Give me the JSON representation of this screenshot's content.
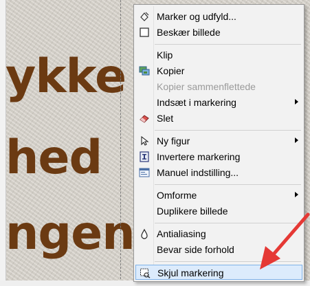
{
  "background": {
    "words": [
      "ykke",
      "hed",
      "ngen"
    ],
    "text_color": "#6b3a12"
  },
  "menu": {
    "items": [
      {
        "label": "Marker og udfyld...",
        "icon": "fill-select-icon",
        "disabled": false,
        "submenu": false
      },
      {
        "label": "Beskær billede",
        "icon": "crop-icon",
        "disabled": false,
        "submenu": false
      },
      {
        "label": "Klip",
        "icon": "",
        "disabled": false,
        "submenu": false
      },
      {
        "label": "Kopier",
        "icon": "copy-icon",
        "disabled": false,
        "submenu": false
      },
      {
        "label": "Kopier sammenflettede",
        "icon": "",
        "disabled": true,
        "submenu": false
      },
      {
        "label": "Indsæt i markering",
        "icon": "",
        "disabled": false,
        "submenu": true
      },
      {
        "label": "Slet",
        "icon": "eraser-icon",
        "disabled": false,
        "submenu": false
      },
      {
        "label": "Ny figur",
        "icon": "pointer-icon",
        "disabled": false,
        "submenu": true
      },
      {
        "label": "Invertere markering",
        "icon": "invert-selection-icon",
        "disabled": false,
        "submenu": false
      },
      {
        "label": "Manuel indstilling...",
        "icon": "manual-settings-icon",
        "disabled": false,
        "submenu": false
      },
      {
        "label": "Omforme",
        "icon": "",
        "disabled": false,
        "submenu": true
      },
      {
        "label": "Duplikere billede",
        "icon": "",
        "disabled": false,
        "submenu": false
      },
      {
        "label": "Antialiasing",
        "icon": "drop-icon",
        "disabled": false,
        "submenu": false
      },
      {
        "label": "Bevar side forhold",
        "icon": "",
        "disabled": false,
        "submenu": false
      },
      {
        "label": "Skjul markering",
        "icon": "hide-selection-icon",
        "disabled": false,
        "submenu": false,
        "highlighted": true
      }
    ]
  },
  "colors": {
    "highlight_bg": "#dcebfc",
    "highlight_border": "#7fb2e8",
    "annotation_arrow": "#e53935"
  }
}
